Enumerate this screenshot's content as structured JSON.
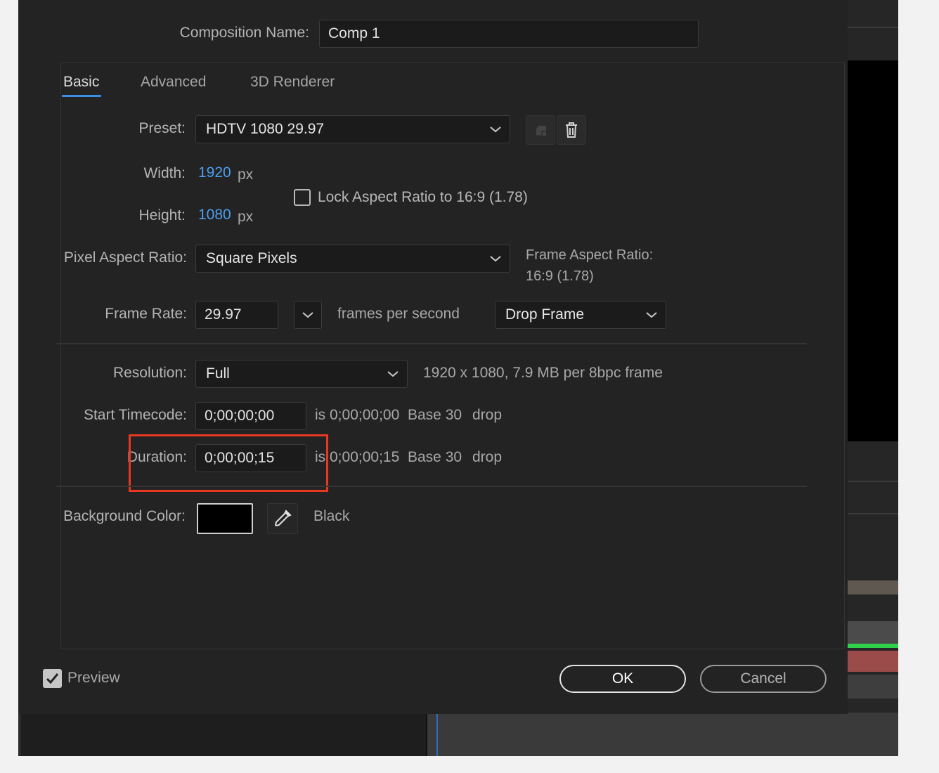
{
  "dialog": {
    "comp_name_label": "Composition Name:",
    "comp_name_value": "Comp 1",
    "tabs": [
      {
        "label": "Basic"
      },
      {
        "label": "Advanced"
      },
      {
        "label": "3D Renderer"
      }
    ],
    "preset": {
      "label": "Preset:",
      "value": "HDTV 1080 29.97"
    },
    "width": {
      "label": "Width:",
      "value": "1920",
      "unit": "px"
    },
    "height": {
      "label": "Height:",
      "value": "1080",
      "unit": "px"
    },
    "lock_aspect": {
      "label": "Lock Aspect Ratio to 16:9 (1.78)",
      "checked": false
    },
    "pixel_aspect": {
      "label": "Pixel Aspect Ratio:",
      "value": "Square Pixels"
    },
    "frame_aspect": {
      "line1": "Frame Aspect Ratio:",
      "line2": "16:9 (1.78)"
    },
    "frame_rate": {
      "label": "Frame Rate:",
      "value": "29.97",
      "unit": "frames per second",
      "mode": "Drop Frame"
    },
    "resolution": {
      "label": "Resolution:",
      "value": "Full",
      "info": "1920 x 1080, 7.9 MB per 8bpc frame"
    },
    "start_timecode": {
      "label": "Start Timecode:",
      "value": "0;00;00;00",
      "is": "is 0;00;00;00",
      "base": "Base 30",
      "drop": "drop"
    },
    "duration": {
      "label": "Duration:",
      "value": "0;00;00;15",
      "is": "is 0;00;00;15",
      "base": "Base 30",
      "drop": "drop"
    },
    "background": {
      "label": "Background Color:",
      "color": "#000000",
      "name": "Black"
    },
    "preview": {
      "label": "Preview",
      "checked": true
    },
    "ok_label": "OK",
    "cancel_label": "Cancel"
  },
  "colors": {
    "accent": "#3b8ee8",
    "highlight": "#e8381f",
    "value_blue": "#4d9ef0"
  }
}
